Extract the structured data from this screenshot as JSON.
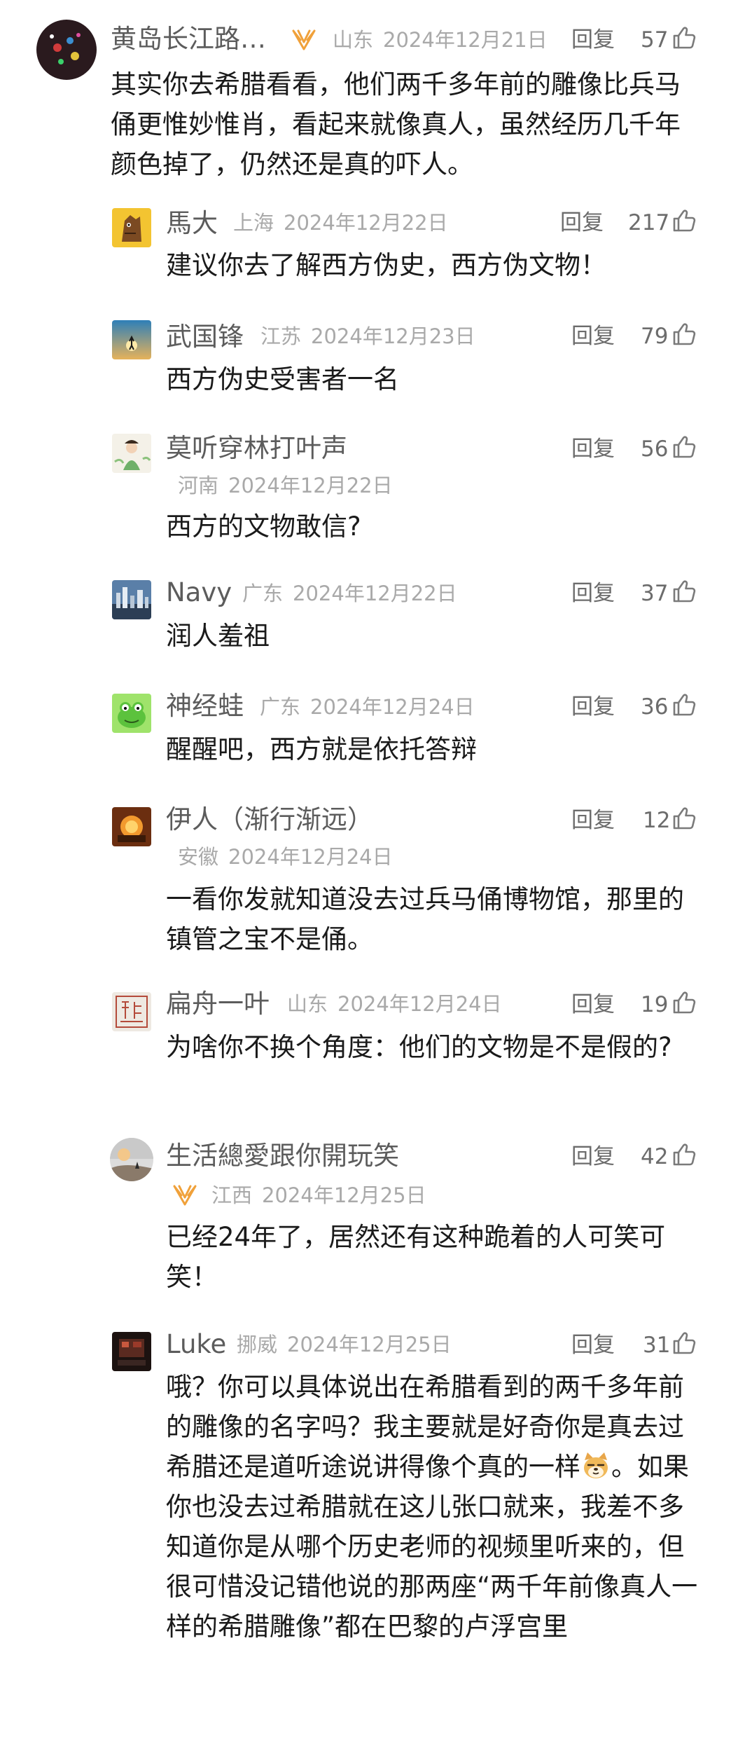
{
  "comments": [
    {
      "name": "黄岛长江路…",
      "location": "山东",
      "date": "2024年12月21日",
      "reply": "回复",
      "likes": "57",
      "text": "其实你去希腊看看，他们两千多年前的雕像比兵马俑更惟妙惟肖，看起来就像真人，虽然经历几千年颜色掉了，仍然还是真的吓人。"
    },
    {
      "name": "馬大",
      "location": "上海",
      "date": "2024年12月22日",
      "reply": "回复",
      "likes": "217",
      "text": "建议你去了解西方伪史，西方伪文物！"
    },
    {
      "name": "武国锋",
      "location": "江苏",
      "date": "2024年12月23日",
      "reply": "回复",
      "likes": "79",
      "text": "西方伪史受害者一名"
    },
    {
      "name": "莫听穿林打叶声",
      "location": "河南",
      "date": "2024年12月22日",
      "reply": "回复",
      "likes": "56",
      "text": "西方的文物敢信?"
    },
    {
      "name": "Navy",
      "location": "广东",
      "date": "2024年12月22日",
      "reply": "回复",
      "likes": "37",
      "text": "润人羞祖"
    },
    {
      "name": "神经蛙",
      "location": "广东",
      "date": "2024年12月24日",
      "reply": "回复",
      "likes": "36",
      "text": "醒醒吧，西方就是依托答辩"
    },
    {
      "name": "伊人（渐行渐远）",
      "location": "安徽",
      "date": "2024年12月24日",
      "reply": "回复",
      "likes": "12",
      "text": "一看你发就知道没去过兵马俑博物馆，那里的镇管之宝不是俑。"
    },
    {
      "name": "扁舟一叶",
      "location": "山东",
      "date": "2024年12月24日",
      "reply": "回复",
      "likes": "19",
      "text": "为啥你不换个角度：他们的文物是不是假的?"
    },
    {
      "name": "生活總愛跟你開玩笑",
      "location": "江西",
      "date": "2024年12月25日",
      "reply": "回复",
      "likes": "42",
      "text": "已经24年了，居然还有这种跪着的人可笑可笑！"
    },
    {
      "name": "Luke",
      "location": "挪威",
      "date": "2024年12月25日",
      "reply": "回复",
      "likes": "31",
      "text": "哦？你可以具体说出在希腊看到的两千多年前的雕像的名字吗？我主要就是好奇你是真去过希腊还是道听途说讲得像个真的一样",
      "text_after_emoji": "。如果你也没去过希腊就在这儿张口就来，我差不多知道你是从哪个历史老师的视频里听来的，但很可惜没记错他说的那两座“两千年前像真人一样的希腊雕像”都在巴黎的卢浮宫里"
    }
  ],
  "icons": {
    "like": "thumbs-up-icon",
    "vip": "vip-badge-icon",
    "emoji": "doge-emoji-icon"
  },
  "colors": {
    "name": "#5c5c5c",
    "meta": "#a9a9a9",
    "text": "#1a1a1a",
    "vip": "#f0a13a"
  }
}
